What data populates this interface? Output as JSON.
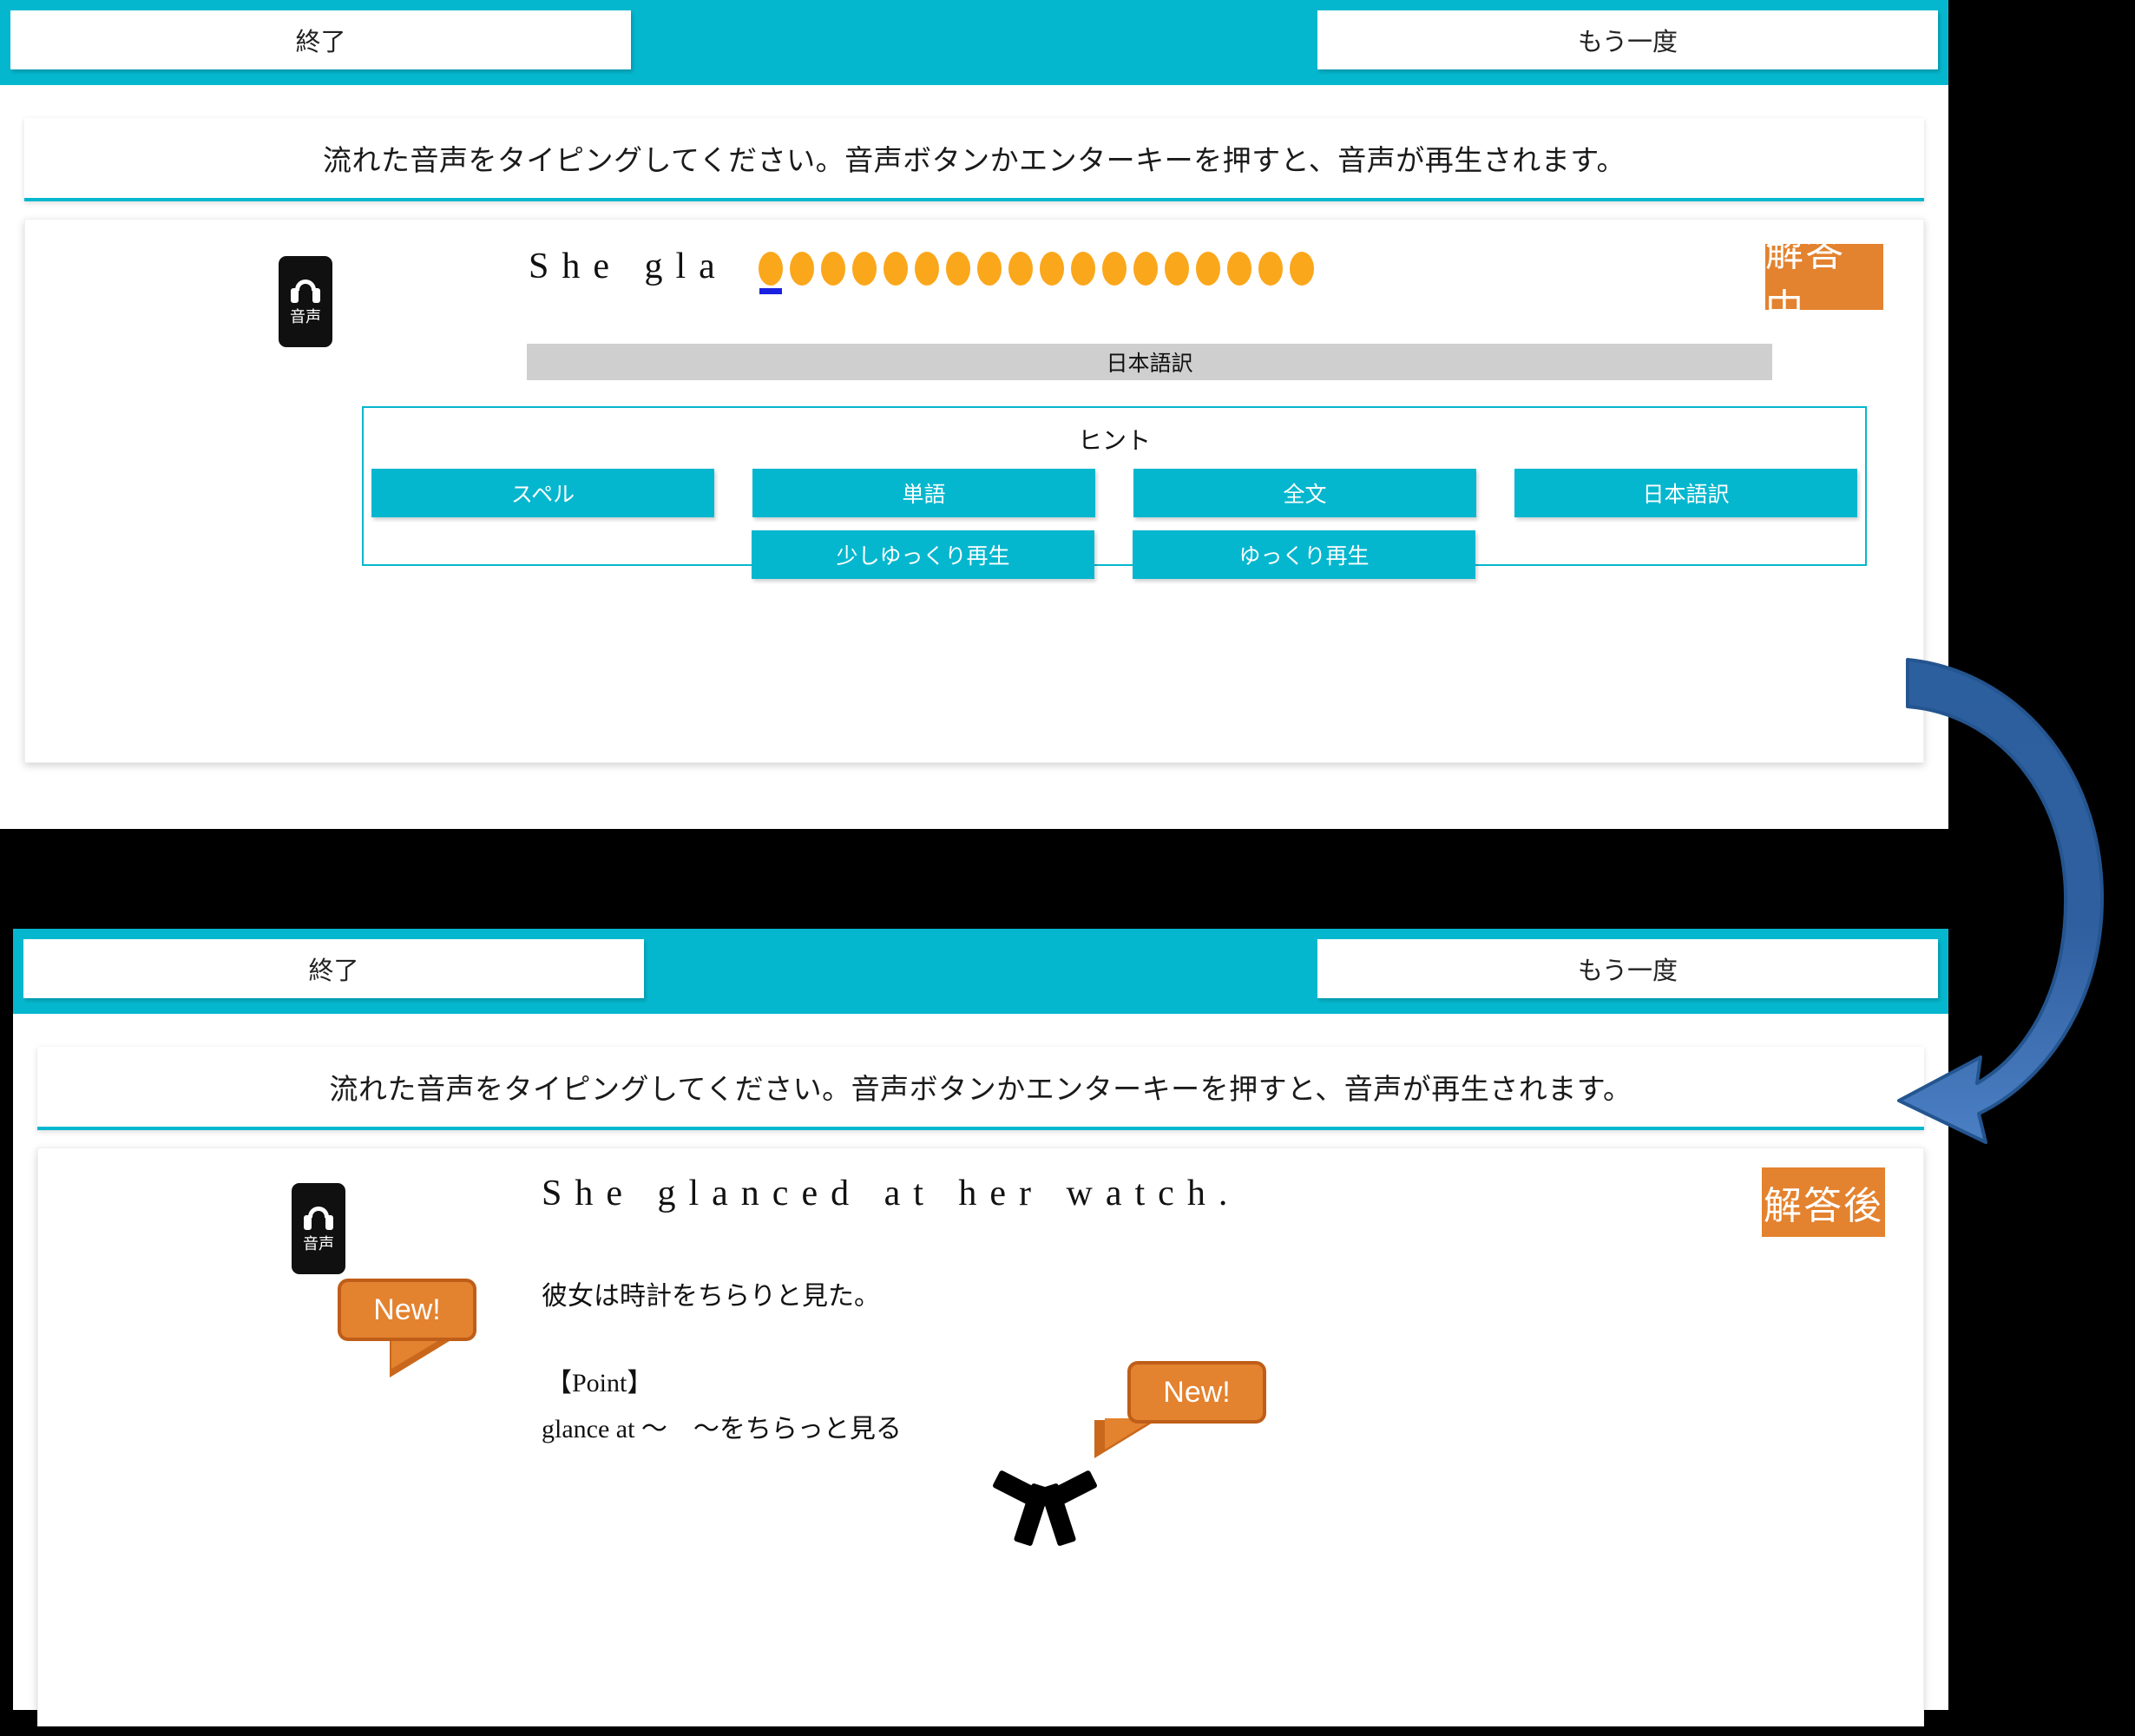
{
  "top_panel": {
    "header": {
      "end_button": "終了",
      "again_button": "もう一度"
    },
    "instruction": "流れた音声をタイピングしてください。音声ボタンかエンターキーを押すと、音声が再生されます。",
    "audio_button_label": "音声",
    "typed_text": "She gla",
    "masked_count": 18,
    "translation_bar": "日本語訳",
    "hint": {
      "title": "ヒント",
      "row1": [
        "スペル",
        "単語",
        "全文",
        "日本語訳"
      ],
      "row2": [
        "少しゆっくり再生",
        "ゆっくり再生"
      ]
    },
    "status_badge": "解答中"
  },
  "bottom_panel": {
    "header": {
      "end_button": "終了",
      "again_button": "もう一度"
    },
    "instruction": "流れた音声をタイピングしてください。音声ボタンかエンターキーを押すと、音声が再生されます。",
    "audio_button_label": "音声",
    "answer_sentence": "She glanced at her watch.",
    "japanese_translation": "彼女は時計をちらりと見た。",
    "point_heading": "【Point】",
    "point_body": "glance at 〜　〜をちらっと見る",
    "status_badge": "解答後",
    "callout_left": "New!",
    "callout_right": "New!"
  },
  "colors": {
    "teal": "#05b7ce",
    "orange_badge": "#E3822F",
    "blob_orange": "#FBA71B",
    "cursor_blue": "#1b21e0",
    "gray_bar": "#cfcfcf",
    "arrow_blue": "#2f6fb5",
    "callout_border": "#BF5E18"
  }
}
